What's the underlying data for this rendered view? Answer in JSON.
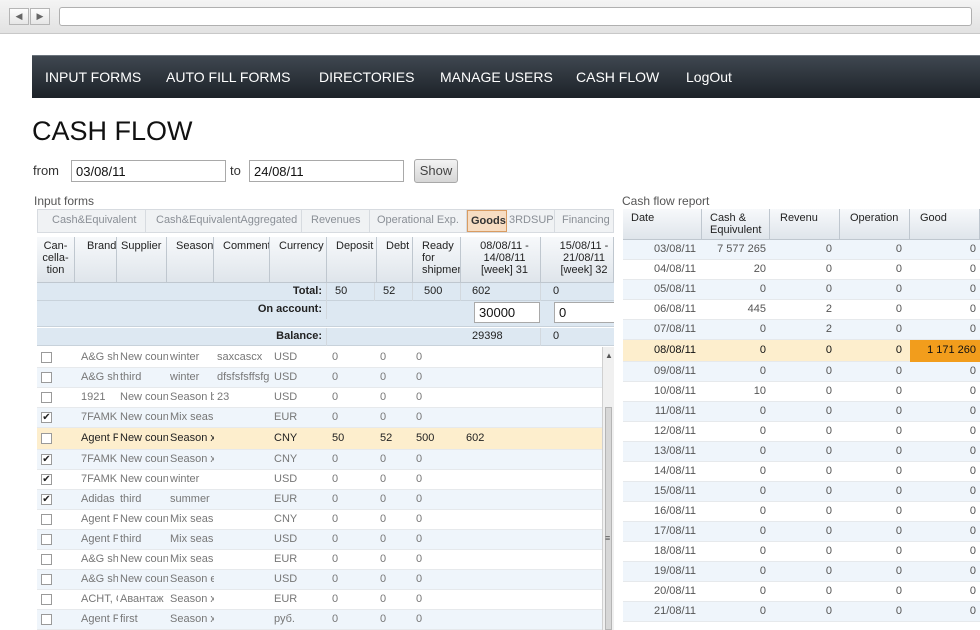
{
  "menu": [
    "INPUT FORMS",
    "AUTO FILL FORMS",
    "DIRECTORIES",
    "MANAGE USERS",
    "CASH FLOW",
    "LogOut"
  ],
  "page_title": "CASH FLOW",
  "filter": {
    "from_label": "from",
    "from_value": "03/08/11",
    "to_label": "to",
    "to_value": "24/08/11",
    "show_label": "Show"
  },
  "input_forms": {
    "title": "Input forms",
    "tabs": [
      "Cash&Equivalent",
      "Cash&EquivalentAggregated",
      "Revenues",
      "Operational Exp.",
      "Goods",
      "3RDSUPL",
      "Financing"
    ],
    "active_tab": "Goods",
    "headers": [
      "Can-cella-tion",
      "Brand",
      "Supplier",
      "Season",
      "Comment",
      "Currency",
      "Deposit",
      "Debt",
      "Ready for shipmen",
      "08/08/11 - 14/08/11 [week] 31",
      "15/08/11 - 21/08/11 [week] 32"
    ],
    "total_label": "Total:",
    "total": [
      "50",
      "52",
      "500",
      "602",
      "0"
    ],
    "on_account_label": "On account:",
    "on_account": [
      "30000",
      "0"
    ],
    "balance_label": "Balance:",
    "balance": [
      "29398",
      "0"
    ],
    "rows": [
      {
        "checked": false,
        "brand": "A&G sh",
        "supplier": "New coun",
        "season": "winter",
        "comment": "saxcascx",
        "currency": "USD",
        "deposit": "0",
        "debt": "0",
        "ready": "0",
        "w1": ""
      },
      {
        "checked": false,
        "brand": "A&G sh",
        "supplier": "third",
        "season": "winter",
        "comment": "dfsfsfsffsfg",
        "currency": "USD",
        "deposit": "0",
        "debt": "0",
        "ready": "0",
        "w1": ""
      },
      {
        "checked": false,
        "brand": "1921",
        "supplier": "New coun",
        "season": "Season b",
        "comment": "23",
        "currency": "USD",
        "deposit": "0",
        "debt": "0",
        "ready": "0",
        "w1": ""
      },
      {
        "checked": true,
        "brand": "7FAMK",
        "supplier": "New coun",
        "season": "Mix seas",
        "comment": "",
        "currency": "EUR",
        "deposit": "0",
        "debt": "0",
        "ready": "0",
        "w1": ""
      },
      {
        "checked": false,
        "brand": "Agent P",
        "supplier": "New coun",
        "season": "Season x",
        "comment": "",
        "currency": "CNY",
        "deposit": "50",
        "debt": "52",
        "ready": "500",
        "w1": "602"
      },
      {
        "checked": true,
        "brand": "7FAMK",
        "supplier": "New coun",
        "season": "Season x",
        "comment": "",
        "currency": "CNY",
        "deposit": "0",
        "debt": "0",
        "ready": "0",
        "w1": ""
      },
      {
        "checked": true,
        "brand": "7FAMK",
        "supplier": "New coun",
        "season": "winter",
        "comment": "",
        "currency": "USD",
        "deposit": "0",
        "debt": "0",
        "ready": "0",
        "w1": ""
      },
      {
        "checked": true,
        "brand": "Adidas",
        "supplier": "third",
        "season": "summer",
        "comment": "",
        "currency": "EUR",
        "deposit": "0",
        "debt": "0",
        "ready": "0",
        "w1": ""
      },
      {
        "checked": false,
        "brand": "Agent P",
        "supplier": "New coun",
        "season": "Mix seas",
        "comment": "",
        "currency": "CNY",
        "deposit": "0",
        "debt": "0",
        "ready": "0",
        "w1": ""
      },
      {
        "checked": false,
        "brand": "Agent P",
        "supplier": "third",
        "season": "Mix seas",
        "comment": "",
        "currency": "USD",
        "deposit": "0",
        "debt": "0",
        "ready": "0",
        "w1": ""
      },
      {
        "checked": false,
        "brand": "A&G sh",
        "supplier": "New coun",
        "season": "Mix seas",
        "comment": "",
        "currency": "EUR",
        "deposit": "0",
        "debt": "0",
        "ready": "0",
        "w1": ""
      },
      {
        "checked": false,
        "brand": "A&G sh",
        "supplier": "New coun",
        "season": "Season e",
        "comment": "",
        "currency": "USD",
        "deposit": "0",
        "debt": "0",
        "ready": "0",
        "w1": ""
      },
      {
        "checked": false,
        "brand": "ACHT, С",
        "supplier": "Авантаж",
        "season": "Season x",
        "comment": "",
        "currency": "EUR",
        "deposit": "0",
        "debt": "0",
        "ready": "0",
        "w1": ""
      },
      {
        "checked": false,
        "brand": "Agent P",
        "supplier": "first",
        "season": "Season x",
        "comment": "",
        "currency": "руб.",
        "deposit": "0",
        "debt": "0",
        "ready": "0",
        "w1": ""
      }
    ],
    "highlight_row": 4
  },
  "report": {
    "title": "Cash flow report",
    "headers": [
      "Date",
      "Cash & Equivulent",
      "Revenu",
      "Operation",
      "Good"
    ],
    "rows": [
      [
        "03/08/11",
        "7 577 265",
        "0",
        "0",
        "0"
      ],
      [
        "04/08/11",
        "20",
        "0",
        "0",
        "0"
      ],
      [
        "05/08/11",
        "0",
        "0",
        "0",
        "0"
      ],
      [
        "06/08/11",
        "445",
        "2",
        "0",
        "0"
      ],
      [
        "07/08/11",
        "0",
        "2",
        "0",
        "0"
      ],
      [
        "08/08/11",
        "0",
        "0",
        "0",
        "1 171 260"
      ],
      [
        "09/08/11",
        "0",
        "0",
        "0",
        "0"
      ],
      [
        "10/08/11",
        "10",
        "0",
        "0",
        "0"
      ],
      [
        "11/08/11",
        "0",
        "0",
        "0",
        "0"
      ],
      [
        "12/08/11",
        "0",
        "0",
        "0",
        "0"
      ],
      [
        "13/08/11",
        "0",
        "0",
        "0",
        "0"
      ],
      [
        "14/08/11",
        "0",
        "0",
        "0",
        "0"
      ],
      [
        "15/08/11",
        "0",
        "0",
        "0",
        "0"
      ],
      [
        "16/08/11",
        "0",
        "0",
        "0",
        "0"
      ],
      [
        "17/08/11",
        "0",
        "0",
        "0",
        "0"
      ],
      [
        "18/08/11",
        "0",
        "0",
        "0",
        "0"
      ],
      [
        "19/08/11",
        "0",
        "0",
        "0",
        "0"
      ],
      [
        "20/08/11",
        "0",
        "0",
        "0",
        "0"
      ],
      [
        "21/08/11",
        "0",
        "0",
        "0",
        "0"
      ]
    ],
    "highlight_row": 5
  },
  "icons": {
    "back": "back-arrow-icon",
    "forward": "forward-arrow-icon",
    "grip": "scroll-grip-icon"
  },
  "colors": {
    "highlight": "#fdeecd",
    "accent": "#f29d1c",
    "menu": "#2a3139"
  }
}
